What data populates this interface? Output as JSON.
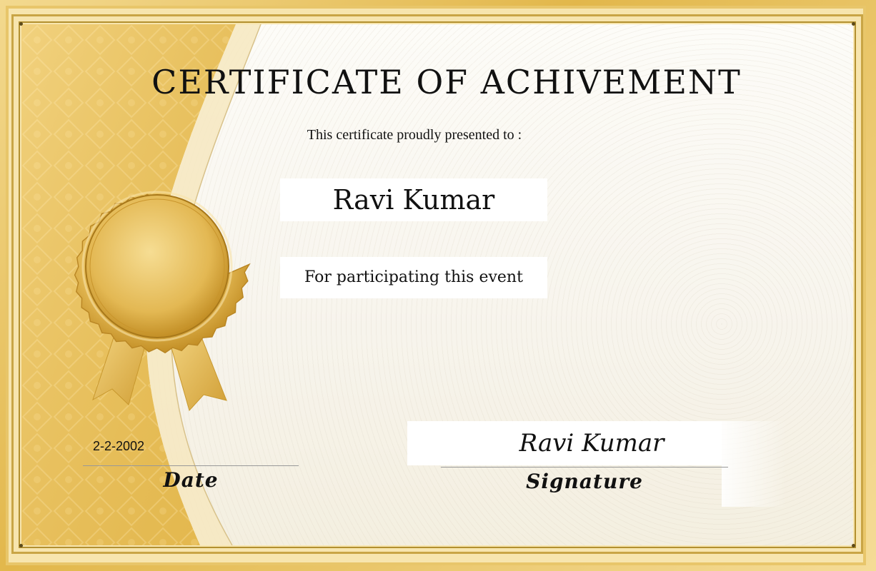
{
  "certificate": {
    "title": "CERTIFICATE OF ACHIVEMENT",
    "subtitle": "This certificate proudly presented to :",
    "recipient_name": "Ravi Kumar",
    "event_text": "For participating this event",
    "date_value": "2-2-2002",
    "date_label": "Date",
    "signature_value": "Ravi Kumar",
    "signature_label": "Signature"
  },
  "decor": {
    "seal_icon": "award-seal-icon",
    "colors": {
      "gold": "#e2b74b",
      "gold_light": "#f5dc97",
      "gold_dark": "#b3902f",
      "paper": "#fdfcf8"
    }
  }
}
